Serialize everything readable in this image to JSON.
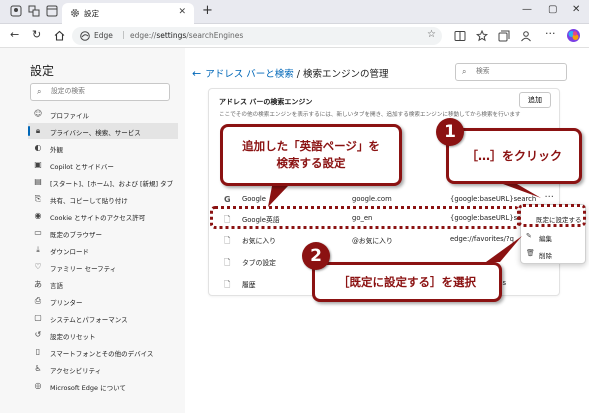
{
  "browser": {
    "tab_title": "設定",
    "url_prefix": "edge://",
    "url_main": "settings",
    "url_suffix": "/searchEngines",
    "app_label": "Edge"
  },
  "sidebar": {
    "title": "設定",
    "search_placeholder": "設定の検索",
    "items": [
      {
        "icon": "person-icon",
        "label": "プロファイル"
      },
      {
        "icon": "lock-icon",
        "label": "プライバシー、検索、サービス"
      },
      {
        "icon": "appearance-icon",
        "label": "外観"
      },
      {
        "icon": "copilot-icon",
        "label": "Copilot とサイドバー"
      },
      {
        "icon": "start-page-icon",
        "label": "[スタート]、[ホーム]、および [新規] タブ"
      },
      {
        "icon": "share-icon",
        "label": "共有、コピーして貼り付け"
      },
      {
        "icon": "cookie-icon",
        "label": "Cookie とサイトのアクセス許可"
      },
      {
        "icon": "browser-icon",
        "label": "既定のブラウザー"
      },
      {
        "icon": "download-icon",
        "label": "ダウンロード"
      },
      {
        "icon": "family-icon",
        "label": "ファミリー セーフティ"
      },
      {
        "icon": "language-icon",
        "label": "言語"
      },
      {
        "icon": "printer-icon",
        "label": "プリンター"
      },
      {
        "icon": "system-icon",
        "label": "システムとパフォーマンス"
      },
      {
        "icon": "reset-icon",
        "label": "設定のリセット"
      },
      {
        "icon": "phone-icon",
        "label": "スマートフォンとその他のデバイス"
      },
      {
        "icon": "accessibility-icon",
        "label": "アクセシビリティ"
      },
      {
        "icon": "edge-icon",
        "label": "Microsoft Edge について"
      }
    ]
  },
  "main": {
    "breadcrumb_link": "アドレス バーと検索",
    "breadcrumb_sep": " / ",
    "breadcrumb_current": "検索エンジンの管理",
    "search_placeholder": "検索",
    "card_title": "アドレス バーの検索エンジン",
    "card_desc": "ここでその他の検索エンジンを表示するには、新しいタブを開き、追加する検索エンジンに移動してから検索を行います",
    "add_button": "追加",
    "rows": [
      {
        "icon": "google-icon",
        "name": "Google",
        "keyword": "google.com",
        "url": "{google:baseURL}search"
      },
      {
        "icon": "page-icon",
        "name": "Google英語",
        "keyword": "go_en",
        "url": "{google:baseURL}se"
      },
      {
        "icon": "page-icon",
        "name": "お気に入り",
        "keyword": "@お気に入り",
        "url": "edge://favorites/?q"
      },
      {
        "icon": "page-icon",
        "name": "タブの設定",
        "keyword": "",
        "url": ""
      },
      {
        "icon": "page-icon",
        "name": "履歴",
        "keyword": "",
        "url": "q=%s"
      }
    ]
  },
  "context_menu": {
    "items": [
      {
        "icon": "",
        "label": "既定に設定する"
      },
      {
        "icon": "edit-icon",
        "label": "編集"
      },
      {
        "icon": "trash-icon",
        "label": "削除"
      }
    ]
  },
  "annotations": {
    "callout_added": [
      "追加した「英語ページ」を",
      "検索する設定"
    ],
    "callout_click": "［…］をクリック",
    "callout_select": "［既定に設定する］を選択",
    "step1": "1",
    "step2": "2",
    "accent_color": "#8b1212"
  }
}
